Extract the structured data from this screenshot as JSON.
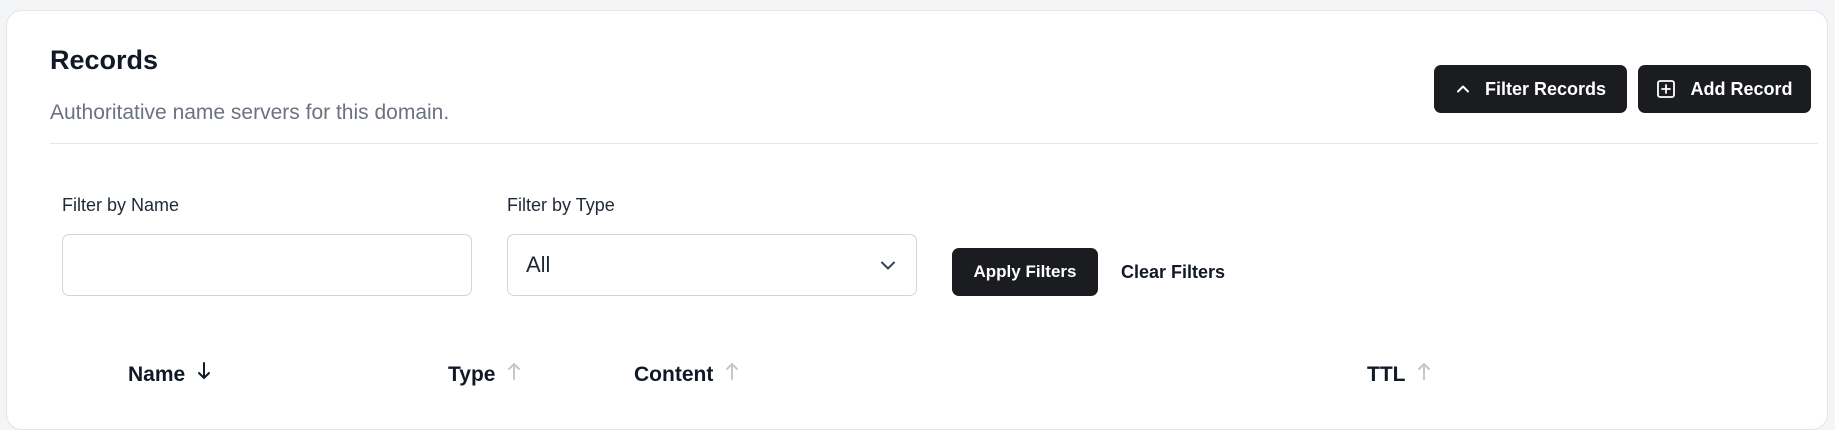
{
  "header": {
    "title": "Records",
    "subtitle": "Authoritative name servers for this domain."
  },
  "actions": {
    "filter_records_label": "Filter Records",
    "filter_records_icon": "chevron-up-icon",
    "add_record_label": "Add Record",
    "add_record_icon": "plus-square-icon"
  },
  "filters": {
    "name_label": "Filter by Name",
    "name_value": "",
    "type_label": "Filter by Type",
    "type_selected": "All",
    "apply_label": "Apply Filters",
    "clear_label": "Clear Filters"
  },
  "table": {
    "columns": [
      {
        "label": "Name",
        "sort": "descending-active"
      },
      {
        "label": "Type",
        "sort": "ascending-inactive"
      },
      {
        "label": "Content",
        "sort": "ascending-inactive"
      },
      {
        "label": "TTL",
        "sort": "ascending-inactive"
      }
    ]
  },
  "colors": {
    "primary_button": "#1b1c1f",
    "muted_text": "#6b7280",
    "inactive_sort_arrow": "#c4c7cc"
  }
}
